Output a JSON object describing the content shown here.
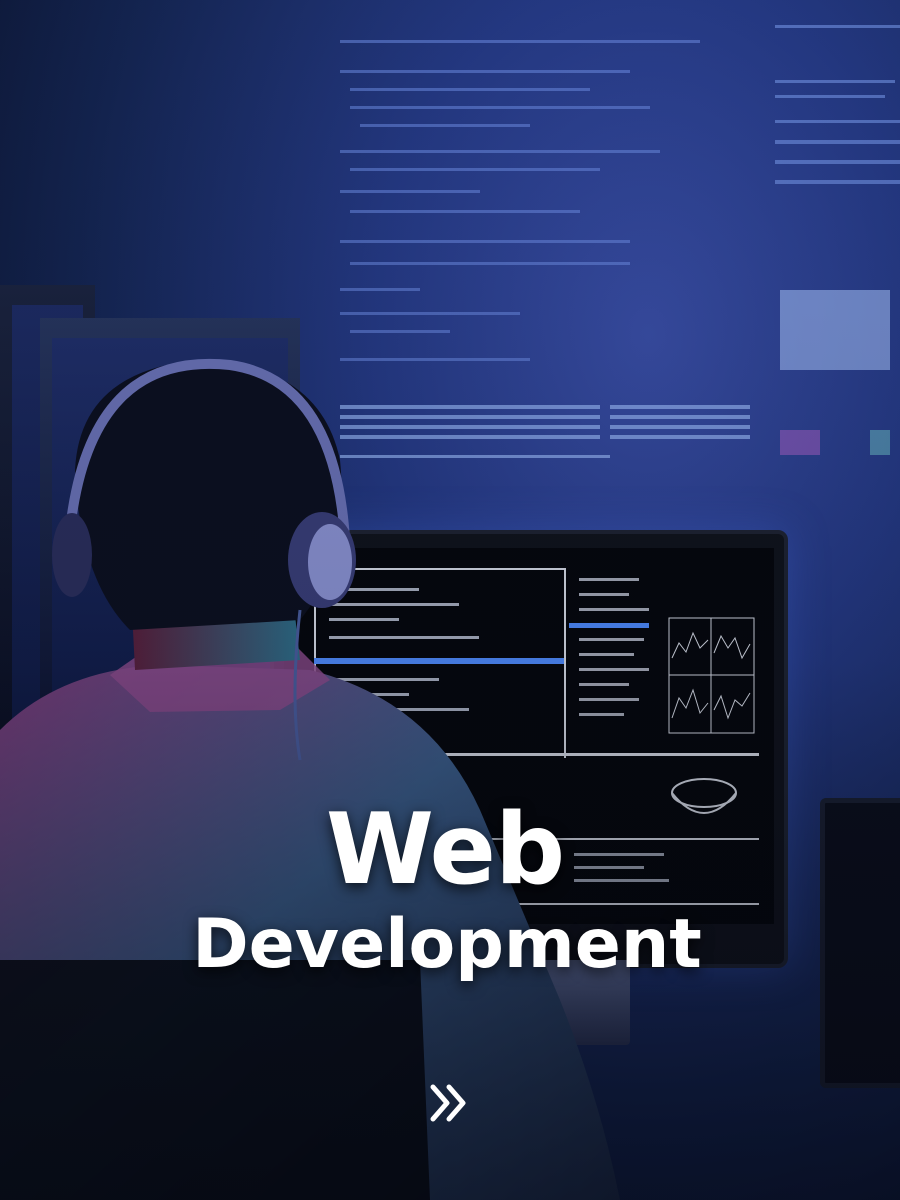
{
  "hero": {
    "title_line1": "Web",
    "title_line2": "Development",
    "text_color": "#ffffff"
  },
  "cta": {
    "icon": "double-chevron-right-icon"
  },
  "colors": {
    "background_glow": "#3a4fa8",
    "background_dark": "#070b1d",
    "screen_accent": "#4f8cff"
  }
}
